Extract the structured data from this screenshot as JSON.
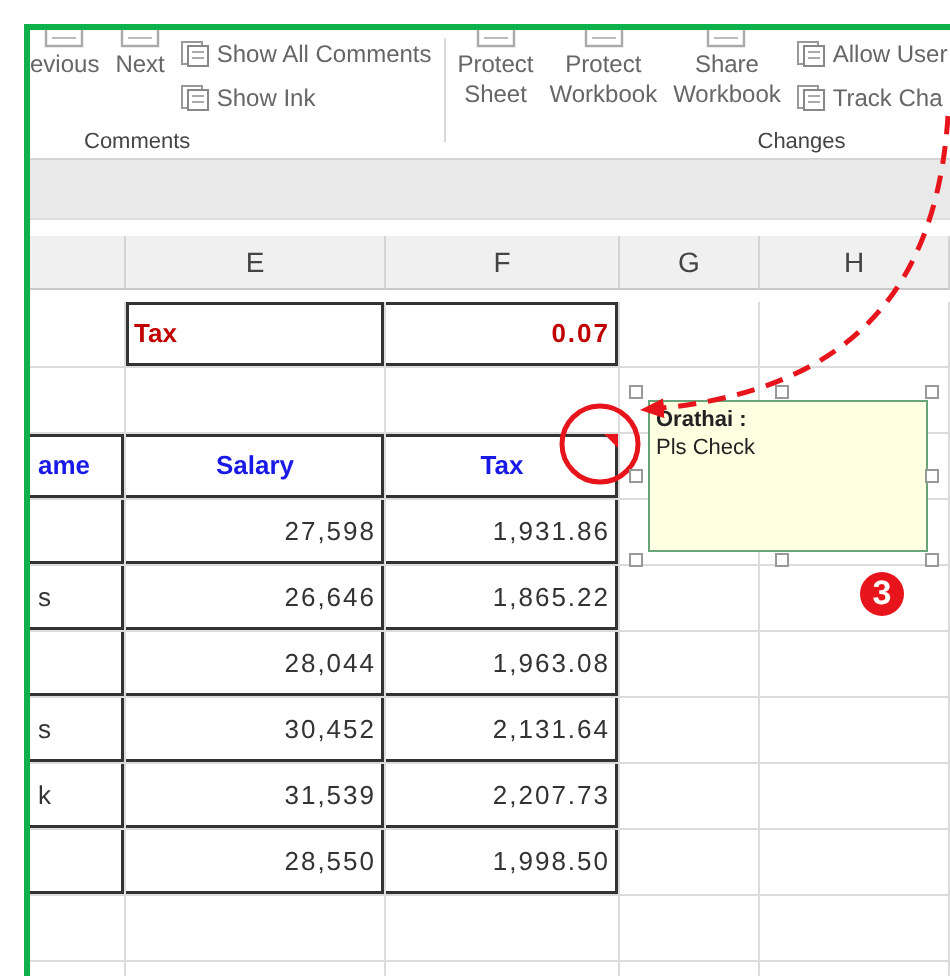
{
  "ribbon": {
    "groups": [
      {
        "label": "Comments",
        "items": [
          {
            "kind": "large",
            "label": "evious"
          },
          {
            "kind": "large",
            "label": "Next"
          },
          {
            "kind": "small",
            "label": "Show All Comments"
          },
          {
            "kind": "small",
            "label": "Show Ink"
          }
        ]
      },
      {
        "label": "Changes",
        "items": [
          {
            "kind": "large",
            "label": "Protect Sheet"
          },
          {
            "kind": "large",
            "label": "Protect Workbook"
          },
          {
            "kind": "large",
            "label": "Share Workbook"
          },
          {
            "kind": "small",
            "label": "Allow User"
          },
          {
            "kind": "small",
            "label": "Track Cha"
          }
        ]
      }
    ]
  },
  "sheet": {
    "column_headers": [
      "E",
      "F",
      "G",
      "H"
    ],
    "rows": [
      {
        "kind": "param",
        "cells": {
          "E": "Tax",
          "F": "0.07"
        }
      },
      {
        "kind": "blank"
      },
      {
        "kind": "header",
        "has_comment": true,
        "cells": {
          "D": "ame",
          "E": "Salary",
          "F": "Tax"
        }
      },
      {
        "kind": "data",
        "cells": {
          "E": "27,598",
          "F": "1,931.86"
        }
      },
      {
        "kind": "data",
        "cells": {
          "D": "s",
          "E": "26,646",
          "F": "1,865.22"
        }
      },
      {
        "kind": "data",
        "cells": {
          "E": "28,044",
          "F": "1,963.08"
        }
      },
      {
        "kind": "data",
        "cells": {
          "D": "s",
          "E": "30,452",
          "F": "2,131.64"
        }
      },
      {
        "kind": "data",
        "cells": {
          "D": "k",
          "E": "31,539",
          "F": "2,207.73"
        }
      },
      {
        "kind": "data",
        "cells": {
          "E": "28,550",
          "F": "1,998.50"
        }
      }
    ]
  },
  "comment": {
    "author": "Orathai :",
    "text": "Pls Check"
  },
  "step": "3"
}
